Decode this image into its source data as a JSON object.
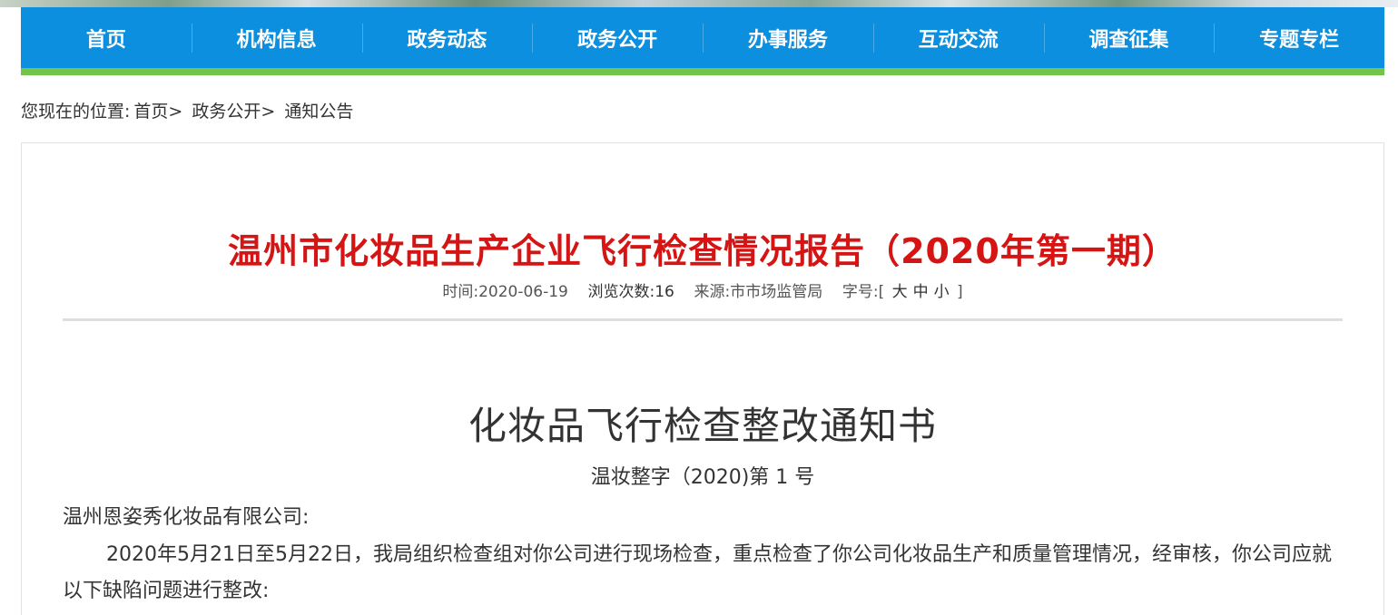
{
  "nav": {
    "items": [
      "首页",
      "机构信息",
      "政务动态",
      "政务公开",
      "办事服务",
      "互动交流",
      "调查征集",
      "专题专栏"
    ]
  },
  "breadcrumb": {
    "prefix": "您现在的位置:",
    "home": "首页>",
    "section": "政务公开>",
    "current": "通知公告"
  },
  "article": {
    "title": "温州市化妆品生产企业飞行检查情况报告（2020年第一期）",
    "meta": {
      "time_label": "时间:",
      "time_value": "2020-06-19",
      "views_label": "浏览次数:",
      "views_value": "16",
      "source_label": "来源:",
      "source_value": "市市场监管局",
      "fontsize_label": "字号:",
      "bracket_open": "[",
      "size_large": "大",
      "size_medium": "中",
      "size_small": "小",
      "bracket_close": "]"
    },
    "doc_title": "化妆品飞行检查整改通知书",
    "doc_number": "温妆整字（2020)第 1 号",
    "recipient": "温州恩姿秀化妆品有限公司:",
    "paragraph": "2020年5月21日至5月22日，我局组织检查组对你公司进行现场检查，重点检查了你公司化妆品生产和质量管理情况，经审核，你公司应就以下缺陷问题进行整改:"
  }
}
